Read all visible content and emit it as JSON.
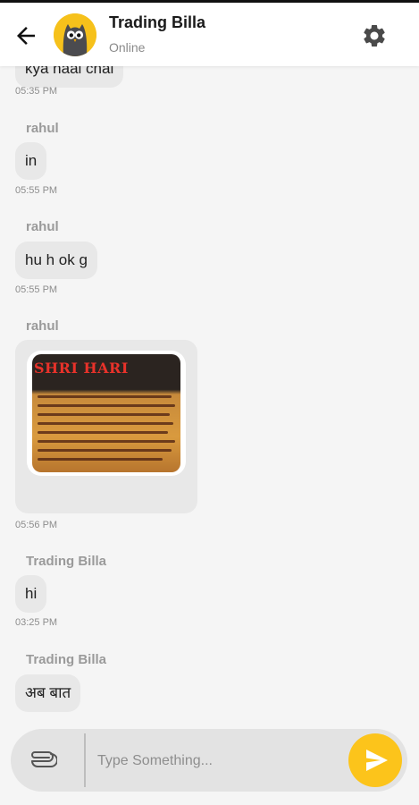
{
  "header": {
    "title": "Trading Billa",
    "status": "Online",
    "back_icon": "arrow-left-icon",
    "settings_icon": "gear-icon",
    "avatar_color": "#f6c11b"
  },
  "messages": [
    {
      "text": "kya haal chal",
      "time": "05:35 PM"
    },
    {
      "sender": "rahul",
      "text": "in",
      "time": "05:55 PM"
    },
    {
      "sender": "rahul",
      "text": "hu h ok g",
      "time": "05:55 PM"
    },
    {
      "sender": "rahul",
      "type": "image",
      "image_brand": "SHRI HARI",
      "time": "05:56 PM"
    },
    {
      "sender": "Trading Billa",
      "text": "hi",
      "time": "03:25 PM"
    },
    {
      "sender": "Trading Billa",
      "text": "अब बात"
    }
  ],
  "composer": {
    "placeholder": "Type Something...",
    "attach_icon": "paperclip-icon",
    "send_icon": "send-icon",
    "send_color": "#fcc41b"
  }
}
